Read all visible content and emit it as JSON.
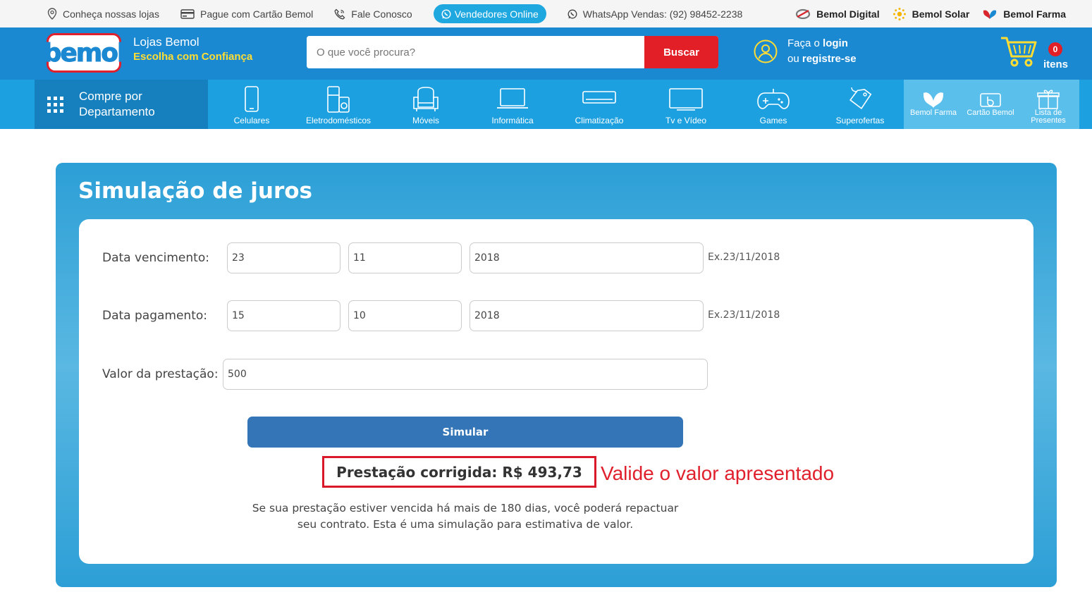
{
  "topbar": {
    "stores": "Conheça nossas lojas",
    "card_pay": "Pague com Cartão Bemol",
    "contact": "Fale Conosco",
    "online_sellers": "Vendedores Online",
    "whatsapp": "WhatsApp Vendas: (92) 98452-2238",
    "digital": "Bemol Digital",
    "solar": "Bemol Solar",
    "farma": "Bemol Farma"
  },
  "header": {
    "logo_text": "bemol",
    "brand_name": "Lojas Bemol",
    "brand_slogan": "Escolha com Confiança",
    "search_placeholder": "O que você procura?",
    "search_button": "Buscar",
    "login_prefix": "Faça o ",
    "login_link": "login",
    "register_prefix": "ou ",
    "register_link": "registre-se",
    "cart_count": "0",
    "cart_label": "itens"
  },
  "nav": {
    "department_line1": "Compre por",
    "department_line2": "Departamento",
    "items": [
      "Celulares",
      "Eletrodomésticos",
      "Móveis",
      "Informática",
      "Climatização",
      "Tv e Vídeo",
      "Games",
      "Superofertas"
    ],
    "right_items": [
      "Bemol Farma",
      "Cartão Bemol",
      "Lista de",
      "Presentes"
    ]
  },
  "simulation": {
    "title": "Simulação de juros",
    "due_label": "Data vencimento:",
    "due_day": "23",
    "due_month": "11",
    "due_year": "2018",
    "due_hint": "Ex.23/11/2018",
    "pay_label": "Data pagamento:",
    "pay_day": "15",
    "pay_month": "10",
    "pay_year": "2018",
    "pay_hint": "Ex.23/11/2018",
    "amount_label": "Valor da prestação:",
    "amount_value": "500",
    "simulate_button": "Simular",
    "result": "Prestação corrigida: R$ 493,73",
    "annotation": "Valide o valor apresentado",
    "note": "Se sua prestação estiver vencida há mais de 180 dias, você poderá repactuar seu contrato. Esta é uma simulação para estimativa de valor."
  },
  "colors": {
    "header_blue": "#1b88d2",
    "nav_blue": "#1ca0e0",
    "accent_red": "#e21f26",
    "slogan_yellow": "#ffdd33",
    "button_blue": "#3375b6"
  }
}
